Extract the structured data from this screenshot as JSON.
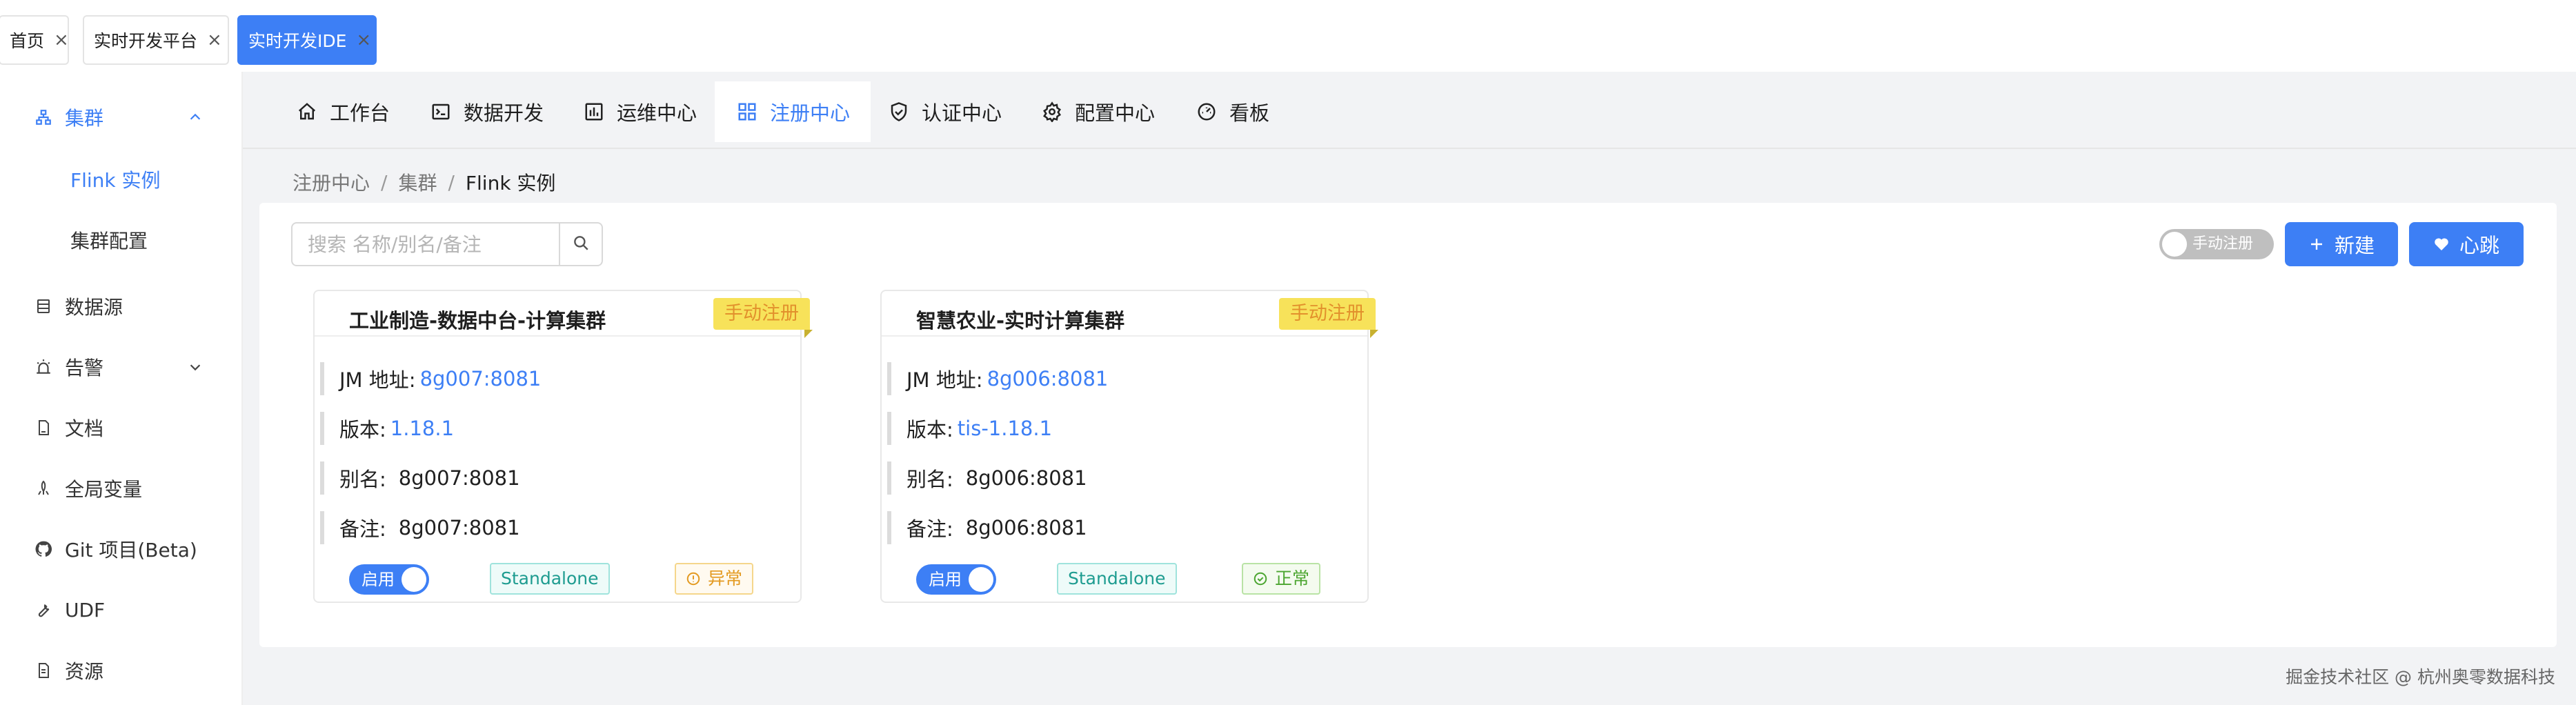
{
  "tabs": [
    {
      "label": "首页",
      "active": false
    },
    {
      "label": "实时开发平台",
      "active": false
    },
    {
      "label": "实时开发IDE",
      "active": true
    }
  ],
  "sidebar": {
    "cluster": {
      "label": "集群",
      "icon": "cluster-icon"
    },
    "cluster_children": [
      "Flink 实例",
      "集群配置"
    ],
    "items": [
      {
        "label": "数据源",
        "icon": "database-icon"
      },
      {
        "label": "告警",
        "icon": "alarm-icon"
      },
      {
        "label": "文档",
        "icon": "document-icon"
      },
      {
        "label": "全局变量",
        "icon": "variable-icon"
      },
      {
        "label": "Git 项目(Beta)",
        "icon": "github-icon"
      },
      {
        "label": "UDF",
        "icon": "wrench-icon"
      },
      {
        "label": "资源",
        "icon": "file-icon"
      }
    ]
  },
  "topnav": [
    {
      "label": "工作台",
      "icon": "home-icon"
    },
    {
      "label": "数据开发",
      "icon": "terminal-icon"
    },
    {
      "label": "运维中心",
      "icon": "ops-icon"
    },
    {
      "label": "注册中心",
      "icon": "grid-icon",
      "active": true
    },
    {
      "label": "认证中心",
      "icon": "shield-icon"
    },
    {
      "label": "配置中心",
      "icon": "gear-icon"
    },
    {
      "label": "看板",
      "icon": "dashboard-icon"
    }
  ],
  "breadcrumb": [
    "注册中心",
    "集群",
    "Flink 实例"
  ],
  "search": {
    "placeholder": "搜索 名称/别名/备注"
  },
  "actions": {
    "manual_register": "手动注册",
    "new": "新建",
    "heartbeat": "心跳"
  },
  "cards": [
    {
      "title": "工业制造-数据中台-计算集群",
      "ribbon": "手动注册",
      "jm_label": "JM 地址:",
      "jm_value": "8g007:8081",
      "version_label": "版本:",
      "version_value": "1.18.1",
      "alias_label": "别名:",
      "alias_value": "8g007:8081",
      "note_label": "备注:",
      "note_value": "8g007:8081",
      "switch_label": "启用",
      "mode": "Standalone",
      "status": "异常",
      "status_type": "warn"
    },
    {
      "title": "智慧农业-实时计算集群",
      "ribbon": "手动注册",
      "jm_label": "JM 地址:",
      "jm_value": "8g006:8081",
      "version_label": "版本:",
      "version_value": "tis-1.18.1",
      "alias_label": "别名:",
      "alias_value": "8g006:8081",
      "note_label": "备注:",
      "note_value": "8g006:8081",
      "switch_label": "启用",
      "mode": "Standalone",
      "status": "正常",
      "status_type": "ok"
    }
  ],
  "footer": "掘金技术社区 @ 杭州奥零数据科技",
  "colors": {
    "primary": "#3d7ff5",
    "ribbon": "#f7e25a",
    "warn": "#e39a21",
    "ok": "#4ca631"
  }
}
